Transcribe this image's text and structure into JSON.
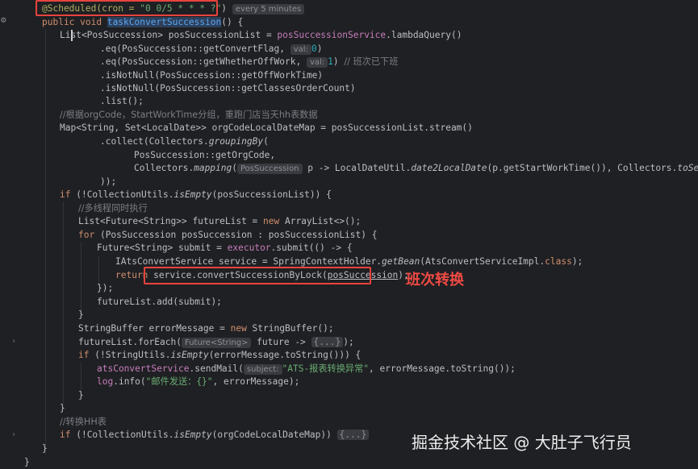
{
  "annotation": {
    "text": "@Scheduled(cron = ",
    "cron": "\"0 0/5 * * * ?\"",
    "close": ")",
    "hint": "every 5 minutes"
  },
  "method_sig": {
    "mods": "public void ",
    "name": "taskConvertSuccession",
    "rest": "() {"
  },
  "code": {
    "l3a": "List<PosSuccession> posSuccessionList = ",
    "l3b": "posSuccessionService",
    "l3c": ".lambdaQuery()",
    "l4a": ".eq(PosSuccession::getConvertFlag, ",
    "l4hint": "val:",
    "l4num": "0",
    "l4c": ")",
    "l5a": ".eq(PosSuccession::getWhetherOffWork, ",
    "l5hint": "val:",
    "l5num": "1",
    "l5c": ") ",
    "l5cm": "// 班次已下班",
    "l6": ".isNotNull(PosSuccession::getOffWorkTime)",
    "l7": ".isNotNull(PosSuccession::getClassesOrderCount)",
    "l8": ".list();",
    "l9cm": "//根据orgCode，StartWorkTime分组，重跑门店当天hh表数据",
    "l10": "Map<String, Set<LocalDate>> orgCodeLocalDateMap = posSuccessionList.stream()",
    "l11a": ".collect(Collectors.",
    "l11b": "groupingBy",
    "l11c": "(",
    "l12": "PosSuccession::getOrgCode,",
    "l13a": "Collectors.",
    "l13b": "mapping",
    "l13c": "(",
    "l13hint": "PosSuccession",
    "l13d": " p -> LocalDateUtil.",
    "l13e": "date2LocalDate",
    "l13f": "(p.getStartWorkTime()), Collectors.",
    "l13g": "toSet",
    "l13h": "())",
    "l14": "));",
    "l15a": "if",
    "l15b": " (!CollectionUtils.",
    "l15c": "isEmpty",
    "l15d": "(posSuccessionList)) {",
    "l16cm": "//多线程同时执行",
    "l17a": "List<Future<String>> futureList = ",
    "l17b": "new",
    "l17c": " ArrayList<>();",
    "l18a": "for",
    "l18b": " (PosSuccession posSuccession : posSuccessionList) {",
    "l19a": "Future<String> submit = ",
    "l19b": "executor",
    "l19c": ".submit(() -> {",
    "l20a": "IAtsConvertService service = SpringContextHolder.",
    "l20b": "getBean",
    "l20c": "(AtsConvertServiceImpl.",
    "l20d": "class",
    "l20e": ");",
    "l21a": "return",
    "l21b": " service.convertSuccessionByLock(",
    "l21c": "posSuccession",
    "l21d": ");",
    "l22": "});",
    "l23": "futureList.add(submit);",
    "l24": "}",
    "l25a": "StringBuffer errorMessage = ",
    "l25b": "new",
    "l25c": " StringBuffer();",
    "l26a": "futureList.forEach(",
    "l26hint": "Future<String>",
    "l26b": " future -> ",
    "l26fold": "{...}",
    "l26c": ");",
    "l27a": "if",
    "l27b": " (!StringUtils.",
    "l27c": "isEmpty",
    "l27d": "(errorMessage.toString())) {",
    "l28a": "atsConvertService",
    "l28b": ".sendMail(",
    "l28hint": "subject:",
    "l28str": "\"ATS-报表转换异常\"",
    "l28c": ", errorMessage.toString());",
    "l29a": "log",
    "l29b": ".info(",
    "l29str": "\"邮件发送：{}\"",
    "l29c": ", errorMessage);",
    "l30": "}",
    "l31": "}",
    "l32cm": "//转换HH表",
    "l33a": "if",
    "l33b": " (!CollectionUtils.",
    "l33c": "isEmpty",
    "l33d": "(orgCodeLocalDateMap)) ",
    "l33fold": "{...}",
    "l34": "}",
    "l35": "}"
  },
  "label_red": "班次转换",
  "watermark": "掘金技术社区 @ 大肚子飞行员",
  "colors": {
    "highlight_box": "#e8433e",
    "label": "#ef4a43",
    "background": "#1f2023"
  }
}
